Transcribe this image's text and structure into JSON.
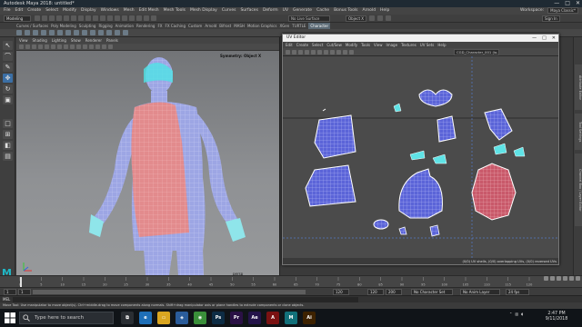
{
  "window": {
    "title": "Autodesk Maya 2018: untitled*",
    "controls": [
      "—",
      "□",
      "✕"
    ]
  },
  "menubar": {
    "items": [
      "File",
      "Edit",
      "Create",
      "Select",
      "Modify",
      "Display",
      "Windows",
      "Mesh",
      "Edit Mesh",
      "Mesh Tools",
      "Mesh Display",
      "Curves",
      "Surfaces",
      "Deform",
      "UV",
      "Generate",
      "Cache",
      "Bonus Tools",
      "Arnold",
      "Help"
    ],
    "workspace_label": "Workspace:",
    "workspace_value": "Maya Classic*"
  },
  "statusline": {
    "mode": "Modeling",
    "surface_field": "No Live Surface",
    "symmetry": "Object X",
    "sign_in": "Sign In"
  },
  "shelf": {
    "tabs": [
      "Curves / Surfaces",
      "Poly Modeling",
      "Sculpting",
      "Rigging",
      "Animation",
      "Rendering",
      "FX",
      "FX Caching",
      "Custom",
      "Arnold",
      "Bifrost",
      "MASH",
      "Motion Graphics",
      "XGen",
      "TURTLE",
      "Character"
    ],
    "active_tab": "Character"
  },
  "viewport": {
    "menu": [
      "View",
      "Shading",
      "Lighting",
      "Show",
      "Renderer",
      "Panels"
    ],
    "symmetry_label": "Symmetry: Object X",
    "camera_label": "persp"
  },
  "uv_editor": {
    "title": "UV Editor",
    "controls": [
      "—",
      "□",
      "✕"
    ],
    "menu": [
      "Edit",
      "Create",
      "Select",
      "Cut/Sew",
      "Modify",
      "Tools",
      "View",
      "Image",
      "Textures",
      "UV Sets",
      "Help"
    ],
    "mesh_field": "CGD_Character_001 (lo...",
    "status": "(0/0) UV shells, (0/0) overlapping UVs, (0/0) reversed UVs"
  },
  "side_tabs": [
    "Attribute Editor",
    "Tool Settings",
    "Channel Box / Layer Editor"
  ],
  "timeline": {
    "ticks": [
      "0",
      "5",
      "10",
      "15",
      "20",
      "25",
      "30",
      "35",
      "40",
      "45",
      "50",
      "55",
      "60",
      "65",
      "70",
      "75",
      "80",
      "85",
      "90",
      "95",
      "100",
      "105",
      "110",
      "115",
      "120"
    ],
    "current_frame": "1"
  },
  "range": {
    "start": "1",
    "start_inner": "1",
    "end_inner": "120",
    "end": "120",
    "end_outer": "200",
    "character_set": "No Character Set",
    "anim_layer": "No Anim Layer",
    "fps": "24 fps"
  },
  "command": {
    "label": "MEL"
  },
  "helpline": {
    "text": "Move Tool: Use manipulator to move object(s). Ctrl+middle-drag to move components along normals. Shift+drag manipulator axis or plane handles to extrude components or clone objects."
  },
  "taskbar": {
    "search_placeholder": "Type here to search",
    "apps": [
      {
        "name": "task-view",
        "label": "⧉",
        "color": "#2a2e33"
      },
      {
        "name": "edge",
        "label": "e",
        "color": "#1e6fb8"
      },
      {
        "name": "explorer",
        "label": "▭",
        "color": "#d9a520"
      },
      {
        "name": "store",
        "label": "◈",
        "color": "#2a5c9a"
      },
      {
        "name": "chrome",
        "label": "◉",
        "color": "#3a8f3a"
      },
      {
        "name": "photoshop",
        "label": "Ps",
        "color": "#0d2c44"
      },
      {
        "name": "premiere",
        "label": "Pr",
        "color": "#2a1145"
      },
      {
        "name": "after-effects",
        "label": "Ae",
        "color": "#24144a"
      },
      {
        "name": "acrobat",
        "label": "A",
        "color": "#7a1212"
      },
      {
        "name": "maya",
        "label": "M",
        "color": "#12707a"
      },
      {
        "name": "illustrator",
        "label": "Ai",
        "color": "#3d2200"
      }
    ],
    "clock_time": "2:47 PM",
    "clock_date": "9/11/2018"
  },
  "colors": {
    "accent": "#3b6fa5",
    "mesh_blue": "#9fa8e6",
    "mesh_red": "#e08a8a",
    "uv_blue": "#5c63d6"
  }
}
